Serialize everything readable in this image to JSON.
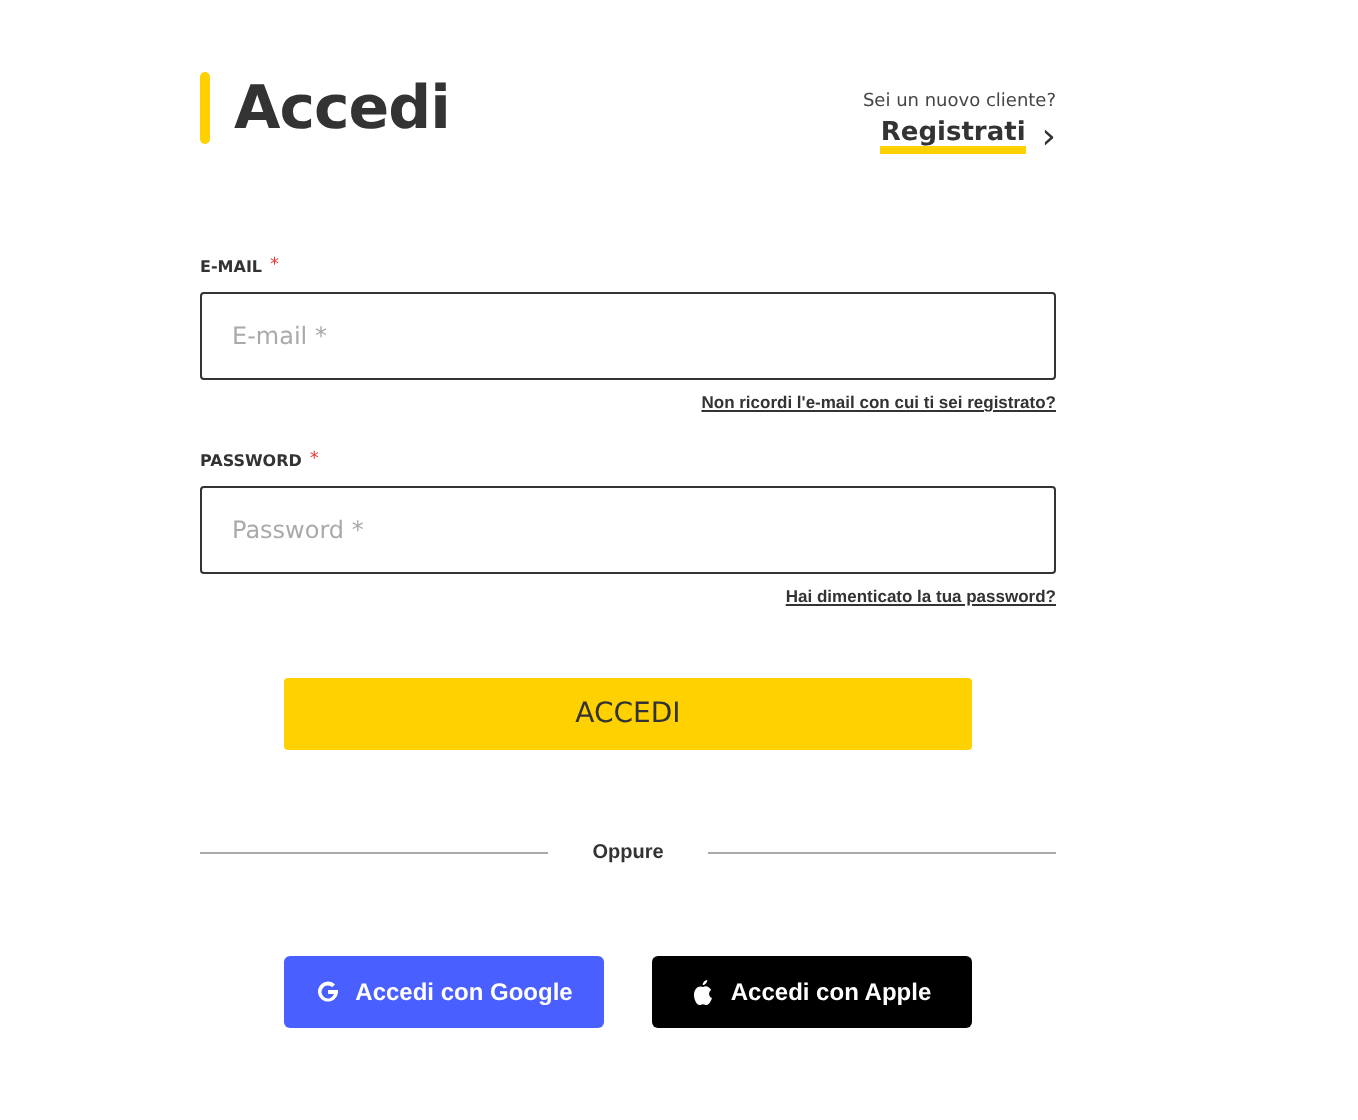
{
  "header": {
    "title": "Accedi",
    "new_customer": "Sei un nuovo cliente?",
    "register_link": "Registrati",
    "chevron": "›"
  },
  "fields": [
    {
      "label": "E-MAIL",
      "required_mark": "*",
      "placeholder": "E-mail *",
      "help_link": "Non ricordi l'e-mail con cui ti sei registrato?"
    },
    {
      "label": "PASSWORD",
      "required_mark": "*",
      "placeholder": "Password *",
      "help_link": "Hai dimenticato la tua password?"
    }
  ],
  "submit_button": "ACCEDI",
  "divider_text": "Oppure",
  "social_buttons": [
    {
      "kind": "google",
      "label": "Accedi con Google"
    },
    {
      "kind": "apple",
      "label": "Accedi con Apple"
    }
  ]
}
